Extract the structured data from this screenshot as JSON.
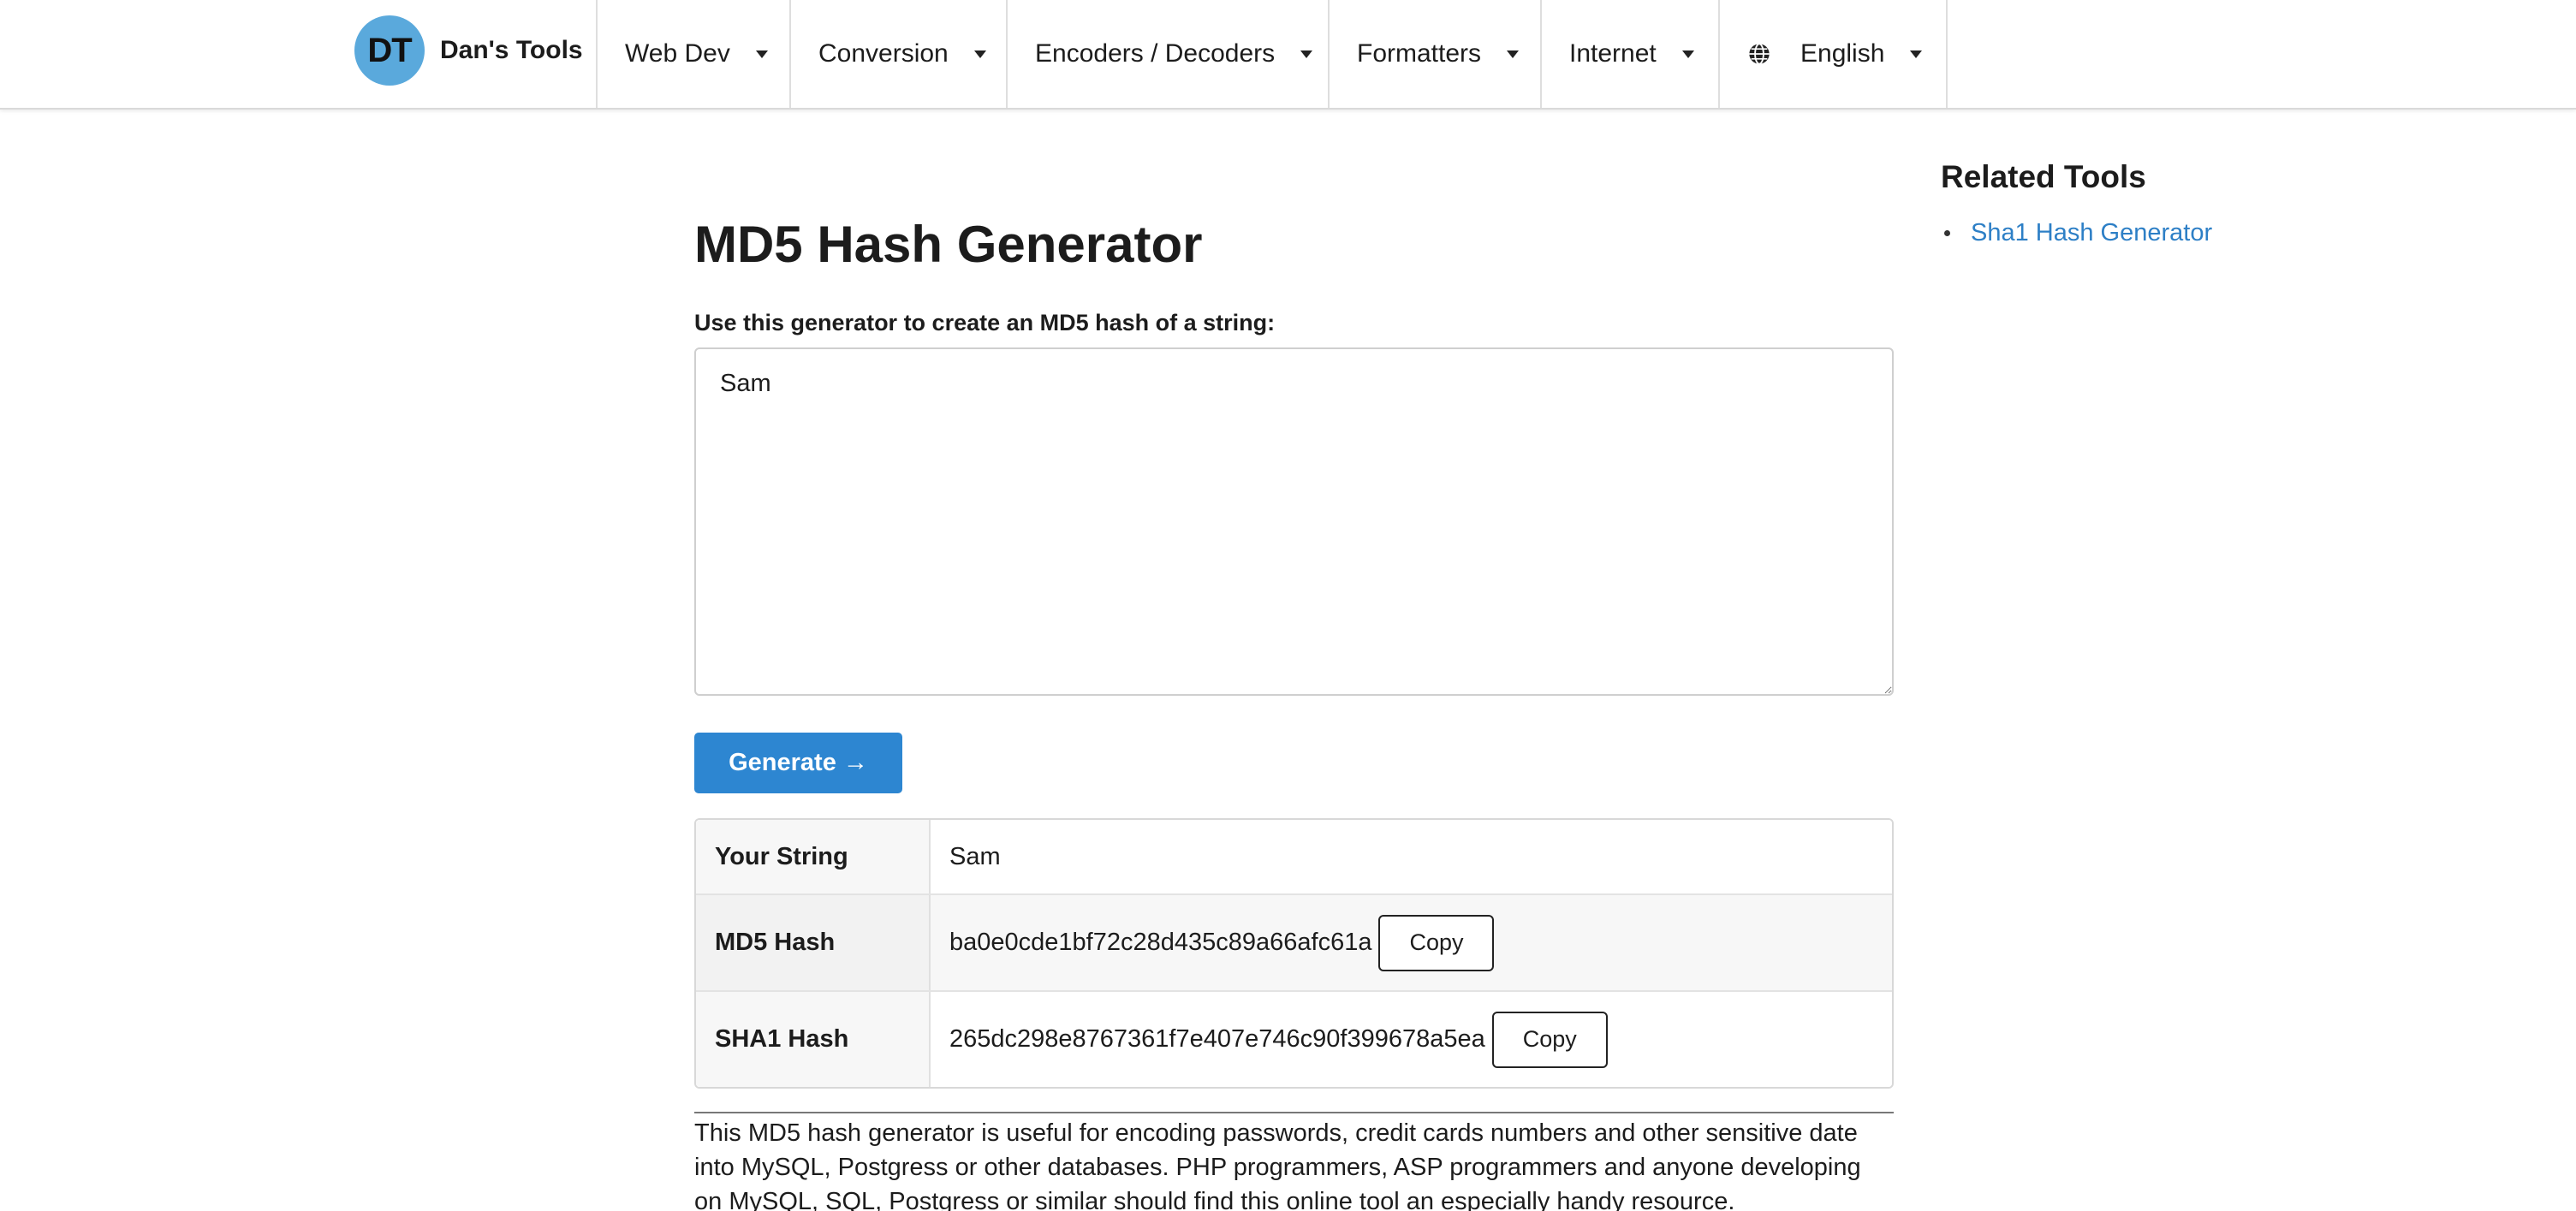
{
  "brand": {
    "logo_text": "DT",
    "name": "Dan's Tools"
  },
  "nav": {
    "items": [
      {
        "label": "Web Dev"
      },
      {
        "label": "Conversion"
      },
      {
        "label": "Encoders / Decoders"
      },
      {
        "label": "Formatters"
      },
      {
        "label": "Internet"
      }
    ],
    "language": {
      "label": "English",
      "icon": "globe-icon"
    }
  },
  "main": {
    "title": "MD5 Hash Generator",
    "intro_label": "Use this generator to create an MD5 hash of a string:",
    "input_value": "Sam",
    "generate_label": "Generate →",
    "results": [
      {
        "key": "Your String",
        "value": "Sam",
        "has_copy": false
      },
      {
        "key": "MD5 Hash",
        "value": "ba0e0cde1bf72c28d435c89a66afc61a",
        "has_copy": true
      },
      {
        "key": "SHA1 Hash",
        "value": "265dc298e8767361f7e407e746c90f399678a5ea",
        "has_copy": true
      }
    ],
    "copy_label": "Copy",
    "description": "This MD5 hash generator is useful for encoding passwords, credit cards numbers and other sensitive date into MySQL, Postgress or other databases. PHP programmers, ASP programmers and anyone developing on MySQL, SQL, Postgress or similar should find this online tool an especially handy resource."
  },
  "sidebar": {
    "title": "Related Tools",
    "links": [
      {
        "label": "Sha1 Hash Generator"
      }
    ]
  },
  "colors": {
    "accent": "#2d86d1",
    "link": "#2d7fc6",
    "logo": "#5aa9dc"
  }
}
